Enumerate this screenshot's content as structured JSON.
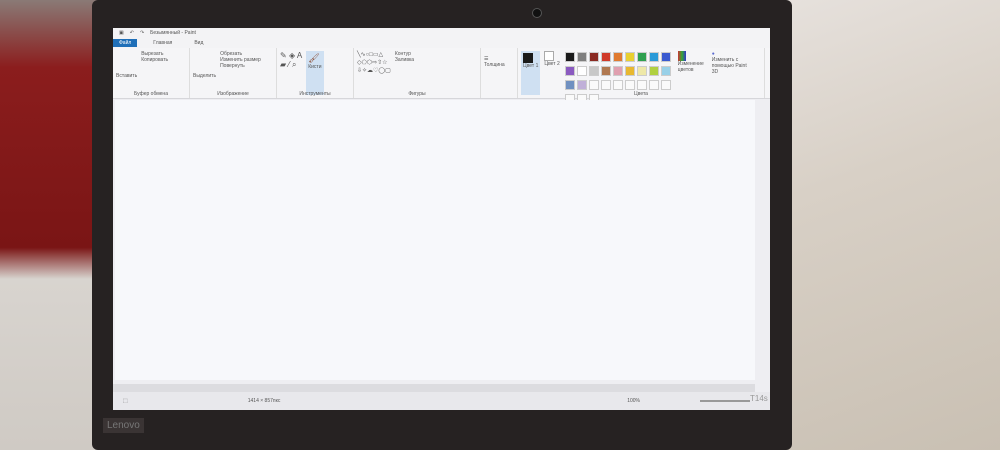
{
  "window_title": "Безымянный - Paint",
  "tabs": [
    "Файл",
    "Главная",
    "Вид"
  ],
  "clipboard": {
    "paste": "Вставить",
    "cut": "Вырезать",
    "copy": "Копировать",
    "label": "Буфер обмена"
  },
  "image": {
    "select": "Выделить",
    "crop": "Обрезать",
    "resize": "Изменить размер",
    "rotate": "Повернуть",
    "label": "Изображение"
  },
  "tools": {
    "label": "Инструменты",
    "brushes": "Кисти"
  },
  "shapes": {
    "label": "Фигуры",
    "outline": "Контур",
    "fill": "Заливка"
  },
  "size_label": "Толщина",
  "colors": {
    "color1": "Цвет 1",
    "color2": "Цвет 2",
    "label": "Цвета",
    "edit": "Изменение цветов",
    "paint3d": "Изменить с помощью Paint 3D",
    "palette": [
      "#1a1a1a",
      "#7f7f7f",
      "#8a2a22",
      "#d03a2a",
      "#e07a30",
      "#e8d030",
      "#30a050",
      "#2a9ad8",
      "#3a5ad0",
      "#8a5ac0",
      "#ffffff",
      "#c8c8c8",
      "#b07850",
      "#e0a0b0",
      "#e8b830",
      "#eee8a8",
      "#b0d040",
      "#98d0e8",
      "#7090c0",
      "#c0b0d8"
    ]
  },
  "status": {
    "dimensions": "1414 × 857пкс",
    "zoom": "100%"
  },
  "laptop": {
    "brand": "Lenovo",
    "model": "T14s"
  }
}
